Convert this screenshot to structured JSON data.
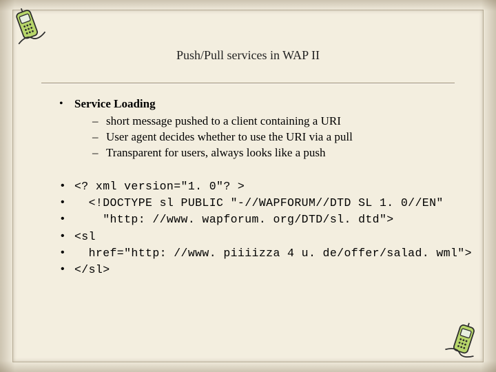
{
  "title": "Push/Pull services in WAP II",
  "main": {
    "heading": "Service Loading",
    "points": [
      "short message pushed to a client containing a URI",
      "User agent decides whether to use the URI via a pull",
      "Transparent for users, always looks like a push"
    ]
  },
  "code": {
    "lines": [
      "<? xml version=\"1. 0\"? >",
      "  <!DOCTYPE sl PUBLIC \"-//WAPFORUM//DTD SL 1. 0//EN\"",
      "    \"http: //www. wapforum. org/DTD/sl. dtd\">",
      "<sl",
      "  href=\"http: //www. piiiizza 4 u. de/offer/salad. wml\">",
      "</sl>"
    ]
  },
  "icons": {
    "phone": "phone-icon"
  }
}
